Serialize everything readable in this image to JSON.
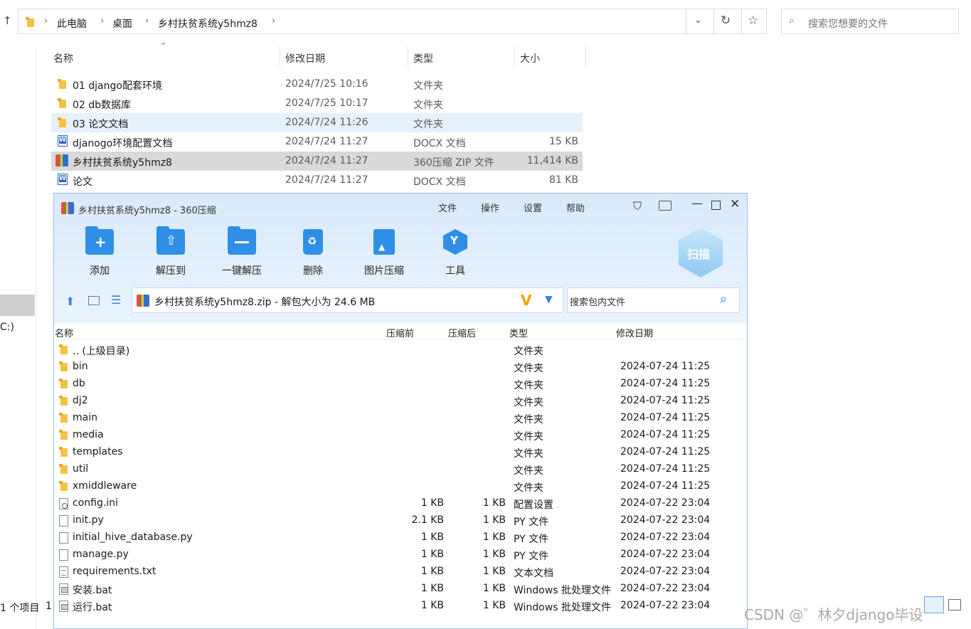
{
  "explorer": {
    "breadcrumb": [
      "此电脑",
      "桌面",
      "乡村扶贫系统y5hmz8"
    ],
    "search_placeholder": "搜索您想要的文件",
    "columns": {
      "name": "名称",
      "date": "修改日期",
      "type": "类型",
      "size": "大小"
    },
    "rows": [
      {
        "name": "01 django配套环境",
        "date": "2024/7/25 10:16",
        "type": "文件夹",
        "size": ""
      },
      {
        "name": "02 db数据库",
        "date": "2024/7/25 10:17",
        "type": "文件夹",
        "size": ""
      },
      {
        "name": "03 论文文档",
        "date": "2024/7/24 11:26",
        "type": "文件夹",
        "size": ""
      },
      {
        "name": "djanogo环境配置文档",
        "date": "2024/7/24 11:27",
        "type": "DOCX 文档",
        "size": "15 KB"
      },
      {
        "name": "乡村扶贫系统y5hmz8",
        "date": "2024/7/24 11:27",
        "type": "360压缩 ZIP 文件",
        "size": "11,414 KB"
      },
      {
        "name": "论文",
        "date": "2024/7/24 11:27",
        "type": "DOCX 文档",
        "size": "81 KB"
      }
    ],
    "sidebar_drive": "C:)",
    "status": "1 个项目",
    "status_2": "1"
  },
  "zip": {
    "title": "乡村扶贫系统y5hmz8 - 360压缩",
    "menu": [
      "文件",
      "操作",
      "设置",
      "帮助"
    ],
    "toolbar": [
      "添加",
      "解压到",
      "一键解压",
      "删除",
      "图片压缩",
      "工具"
    ],
    "scan_label": "扫描",
    "path": "乡村扶贫系统y5hmz8.zip - 解包大小为 24.6 MB",
    "search_placeholder": "搜索包内文件",
    "columns": {
      "name": "名称",
      "compressed_before": "压缩前",
      "compressed_after": "压缩后",
      "type": "类型",
      "date": "修改日期"
    },
    "rows": [
      {
        "name": ".. (上级目录)",
        "before": "",
        "after": "",
        "type": "文件夹",
        "date": "",
        "icon": "folder"
      },
      {
        "name": "bin",
        "before": "",
        "after": "",
        "type": "文件夹",
        "date": "2024-07-24 11:25",
        "icon": "folder"
      },
      {
        "name": "db",
        "before": "",
        "after": "",
        "type": "文件夹",
        "date": "2024-07-24 11:25",
        "icon": "folder"
      },
      {
        "name": "dj2",
        "before": "",
        "after": "",
        "type": "文件夹",
        "date": "2024-07-24 11:25",
        "icon": "folder"
      },
      {
        "name": "main",
        "before": "",
        "after": "",
        "type": "文件夹",
        "date": "2024-07-24 11:25",
        "icon": "folder"
      },
      {
        "name": "media",
        "before": "",
        "after": "",
        "type": "文件夹",
        "date": "2024-07-24 11:25",
        "icon": "folder"
      },
      {
        "name": "templates",
        "before": "",
        "after": "",
        "type": "文件夹",
        "date": "2024-07-24 11:25",
        "icon": "folder"
      },
      {
        "name": "util",
        "before": "",
        "after": "",
        "type": "文件夹",
        "date": "2024-07-24 11:25",
        "icon": "folder"
      },
      {
        "name": "xmiddleware",
        "before": "",
        "after": "",
        "type": "文件夹",
        "date": "2024-07-24 11:25",
        "icon": "folder"
      },
      {
        "name": "config.ini",
        "before": "1 KB",
        "after": "1 KB",
        "type": "配置设置",
        "date": "2024-07-22 23:04",
        "icon": "cfg"
      },
      {
        "name": "init.py",
        "before": "2.1 KB",
        "after": "1 KB",
        "type": "PY 文件",
        "date": "2024-07-22 23:04",
        "icon": "file"
      },
      {
        "name": "initial_hive_database.py",
        "before": "1 KB",
        "after": "1 KB",
        "type": "PY 文件",
        "date": "2024-07-22 23:04",
        "icon": "file"
      },
      {
        "name": "manage.py",
        "before": "1 KB",
        "after": "1 KB",
        "type": "PY 文件",
        "date": "2024-07-22 23:04",
        "icon": "file"
      },
      {
        "name": "requirements.txt",
        "before": "1 KB",
        "after": "1 KB",
        "type": "文本文档",
        "date": "2024-07-22 23:04",
        "icon": "txt"
      },
      {
        "name": "安装.bat",
        "before": "1 KB",
        "after": "1 KB",
        "type": "Windows 批处理文件",
        "date": "2024-07-22 23:04",
        "icon": "bat"
      },
      {
        "name": "运行.bat",
        "before": "1 KB",
        "after": "1 KB",
        "type": "Windows 批处理文件",
        "date": "2024-07-22 23:04",
        "icon": "bat"
      }
    ]
  },
  "watermark": "CSDN @゛林夕django毕设"
}
